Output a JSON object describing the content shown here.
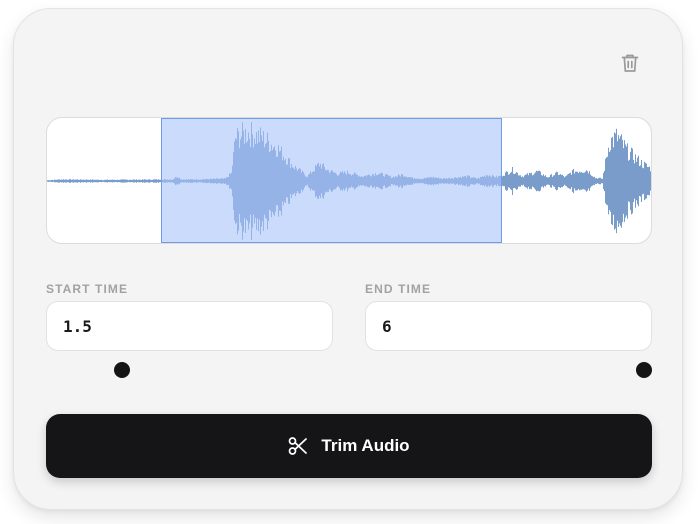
{
  "toolbar": {
    "delete_icon": "trash-icon"
  },
  "waveform": {
    "duration_seconds": 8,
    "selection_start_seconds": 1.5,
    "selection_end_seconds": 6,
    "wave_color": "#7a9ccb",
    "selection_fill": "#c9d9fb",
    "selection_border": "#6f9be8"
  },
  "start_time": {
    "label": "START TIME",
    "value": "1.5"
  },
  "end_time": {
    "label": "END TIME",
    "value": "6"
  },
  "trim_button": {
    "label": "Trim Audio",
    "icon": "scissors-icon",
    "background": "#151517"
  }
}
